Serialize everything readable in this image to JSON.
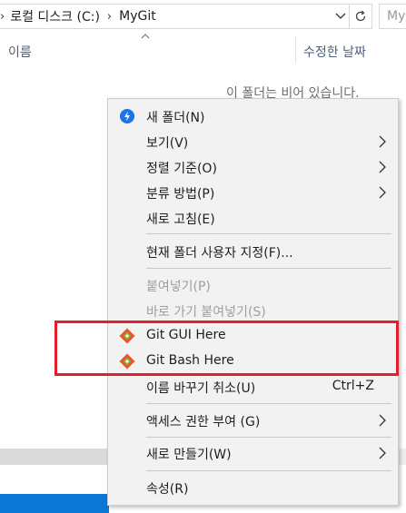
{
  "address_bar": {
    "crumbs": [
      "로컬 디스크 (C:)",
      "MyGit"
    ],
    "search_placeholder": "My"
  },
  "columns": {
    "name": "이름",
    "date_modified": "수정한 날짜"
  },
  "empty_message": "이 폴더는 비어 있습니다.",
  "context_menu": {
    "items": [
      {
        "label": "새 폴더(N)",
        "icon": "new-folder-icon"
      },
      {
        "label": "보기(V)",
        "submenu": true
      },
      {
        "label": "정렬 기준(O)",
        "submenu": true
      },
      {
        "label": "분류 방법(P)",
        "submenu": true
      },
      {
        "label": "새로 고침(E)"
      },
      {
        "label": "현재 폴더 사용자 지정(F)..."
      },
      {
        "label": "붙여넣기(P)",
        "disabled": true
      },
      {
        "label": "바로 가기 붙여넣기(S)",
        "disabled": true
      },
      {
        "label": "Git GUI Here",
        "icon": "git-icon"
      },
      {
        "label": "Git Bash Here",
        "icon": "git-icon"
      },
      {
        "label": "이름 바꾸기 취소(U)",
        "shortcut": "Ctrl+Z"
      },
      {
        "label": "액세스 권한 부여 (G)",
        "submenu": true
      },
      {
        "label": "새로 만들기(W)",
        "submenu": true
      },
      {
        "label": "속성(R)"
      }
    ]
  },
  "colors": {
    "highlight_border": "#e0202a",
    "taskbar_blue": "#0a78d4",
    "menu_background": "#f2f2f2"
  }
}
